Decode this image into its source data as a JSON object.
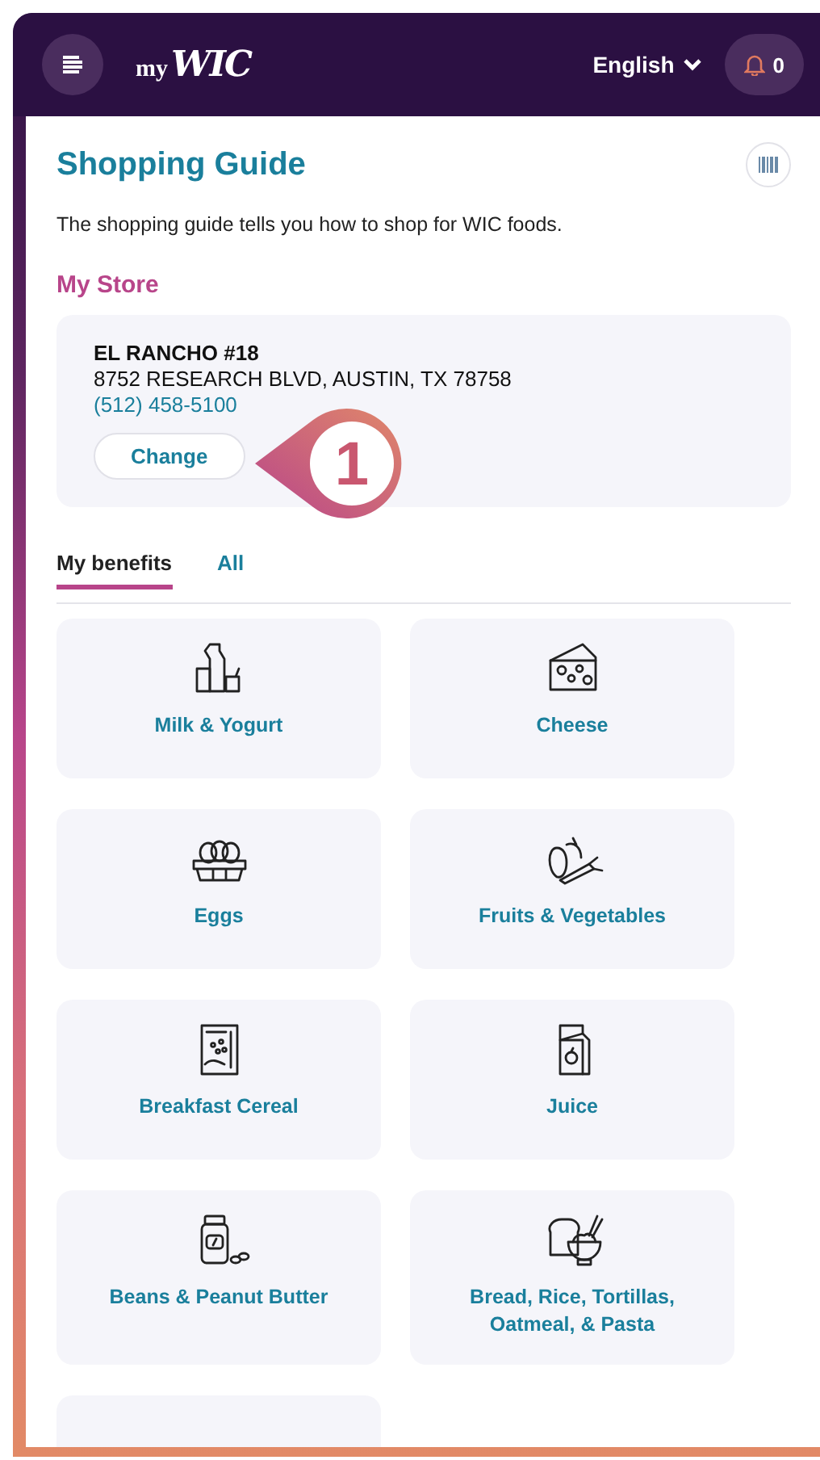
{
  "header": {
    "logo_prefix": "my",
    "logo_name": "WIC",
    "language": "English",
    "notifications": "0"
  },
  "page": {
    "title": "Shopping Guide",
    "description": "The shopping guide tells you how to shop for WIC foods."
  },
  "store_section": {
    "heading": "My Store",
    "name": "EL RANCHO #18",
    "address": "8752 RESEARCH BLVD, AUSTIN, TX 78758",
    "phone": "(512) 458-5100",
    "button": "Change",
    "callout": "1"
  },
  "tabs": [
    {
      "label": "My benefits",
      "selected": true
    },
    {
      "label": "All",
      "selected": false
    }
  ],
  "categories": [
    {
      "label": "Milk & Yogurt"
    },
    {
      "label": "Cheese"
    },
    {
      "label": "Eggs"
    },
    {
      "label": "Fruits & Vegetables"
    },
    {
      "label": "Breakfast Cereal"
    },
    {
      "label": "Juice"
    },
    {
      "label": "Beans & Peanut Butter"
    },
    {
      "label": "Bread, Rice, Tortillas, Oatmeal, & Pasta"
    }
  ]
}
